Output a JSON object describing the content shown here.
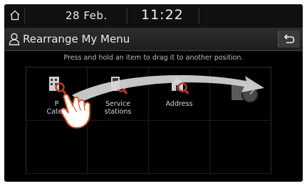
{
  "status": {
    "date": "28 Feb.",
    "time": "11:22"
  },
  "header": {
    "title": "Rearrange My Menu"
  },
  "hint": "Press and hold an item to drag it to another position.",
  "menu_items": [
    {
      "label": "POI\nCategories",
      "label_visible": "P\nCateg"
    },
    {
      "label": "Service\nstations"
    },
    {
      "label": "Address"
    },
    {
      "label": ""
    }
  ],
  "colors": {
    "background": "#000000",
    "accent_icon": "#c0392b",
    "arrow": "#d9d9d9"
  }
}
